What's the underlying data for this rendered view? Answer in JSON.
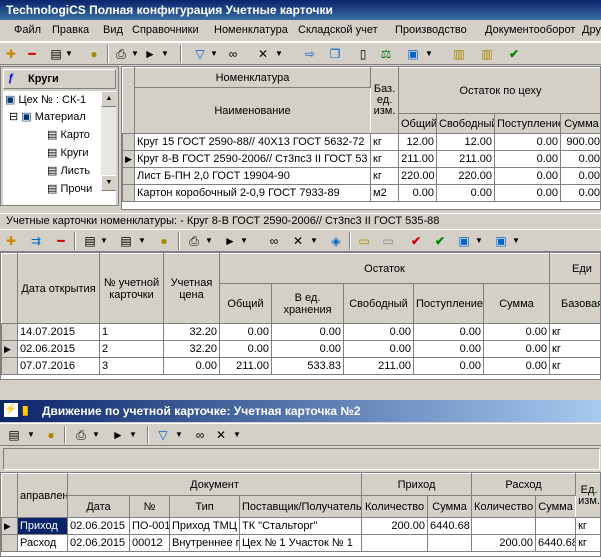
{
  "title": "TechnologiCS Полная конфигурация Учетные карточки",
  "menu": [
    "Файл",
    "Правка",
    "Вид",
    "Справочники",
    "Номенклатура",
    "Складской учет",
    "Производство",
    "Документооборот",
    "Дру"
  ],
  "icons": {
    "add": "add-icon",
    "delete": "delete-icon",
    "doc": "document-icon",
    "lock": "lock-icon",
    "print": "printer-icon",
    "play": "play-icon",
    "filter": "filter-icon",
    "binoculars": "binoculars-icon",
    "tools": "tools-icon",
    "check": "check-icon"
  },
  "top_panel": {
    "left_caption": "Круги",
    "tree": [
      "Цех № : СК-1",
      "Материал",
      "Карто",
      "Круги",
      "Листь",
      "Прочи"
    ],
    "columns": {
      "group_nom": "Номенклатура",
      "name": "Наименование",
      "unit": "Баз. ед. изм.",
      "group_rest": "Остаток по цеху",
      "total": "Общий",
      "free": "Свободный",
      "incoming": "Поступление",
      "sum": "Сумма"
    },
    "rows": [
      {
        "name": "Круг 15 ГОСТ 2590-88// 40Х13 ГОСТ 5632-72",
        "unit": "кг",
        "total": "12.00",
        "free": "12.00",
        "incoming": "0.00",
        "sum": "900.00"
      },
      {
        "name": "Круг 8-В ГОСТ 2590-2006// Ст3пс3 II ГОСТ 53",
        "unit": "кг",
        "total": "211.00",
        "free": "211.00",
        "incoming": "0.00",
        "sum": "0.00"
      },
      {
        "name": "Лист Б-ПН 2,0 ГОСТ 19904-90",
        "unit": "кг",
        "total": "220.00",
        "free": "220.00",
        "incoming": "0.00",
        "sum": "0.00"
      },
      {
        "name": "Картон коробочный 2-0,9 ГОСТ 7933-89",
        "unit": "м2",
        "total": "0.00",
        "free": "0.00",
        "incoming": "0.00",
        "sum": "0.00"
      }
    ]
  },
  "middle_panel": {
    "caption": "Учетные карточки номенклатуры: - Круг 8-В ГОСТ 2590-2006// Ст3пс3 II ГОСТ 535-88",
    "columns": {
      "date": "Дата открытия",
      "num": "№ учетной карточки",
      "price": "Учетная цена",
      "group_rest": "Остаток",
      "total": "Общий",
      "in_units": "В ед. хранения",
      "free": "Свободный",
      "incoming": "Поступление",
      "sum": "Сумма",
      "group_unit": "Еди",
      "base": "Базовая"
    },
    "rows": [
      {
        "date": "14.07.2015",
        "num": "1",
        "price": "32.20",
        "total": "0.00",
        "in_units": "0.00",
        "free": "0.00",
        "incoming": "0.00",
        "sum": "0.00",
        "base": "кг"
      },
      {
        "date": "02.06.2015",
        "num": "2",
        "price": "32.20",
        "total": "0.00",
        "in_units": "0.00",
        "free": "0.00",
        "incoming": "0.00",
        "sum": "0.00",
        "base": "кг"
      },
      {
        "date": "07.07.2016",
        "num": "3",
        "price": "0.00",
        "total": "211.00",
        "in_units": "533.83",
        "free": "211.00",
        "incoming": "0.00",
        "sum": "0.00",
        "base": "кг"
      }
    ]
  },
  "bottom_panel": {
    "title": "Движение по учетной карточке: Учетная карточка №2",
    "columns": {
      "direction": "аправлен",
      "group_doc": "Документ",
      "date": "Дата",
      "num": "№",
      "type": "Тип",
      "partner": "Поставщик/Получатель",
      "group_in": "Приход",
      "in_qty": "Количество",
      "in_sum": "Сумма",
      "group_out": "Расход",
      "out_qty": "Количество",
      "out_sum": "Сумма",
      "unit": "Ед. изм."
    },
    "rows": [
      {
        "direction": "Приход",
        "date": "02.06.2015",
        "num": "ПО-001",
        "type": "Приход ТМЦ",
        "partner": "ТК \"Стальторг\"",
        "in_qty": "200.00",
        "in_sum": "6440.68",
        "out_qty": "",
        "out_sum": "",
        "unit": "кг"
      },
      {
        "direction": "Расход",
        "date": "02.06.2015",
        "num": "00012",
        "type": "Внутреннее п",
        "partner": "Цех № 1 Участок № 1",
        "in_qty": "",
        "in_sum": "",
        "out_qty": "200.00",
        "out_sum": "6440.68",
        "unit": "кг"
      }
    ]
  }
}
